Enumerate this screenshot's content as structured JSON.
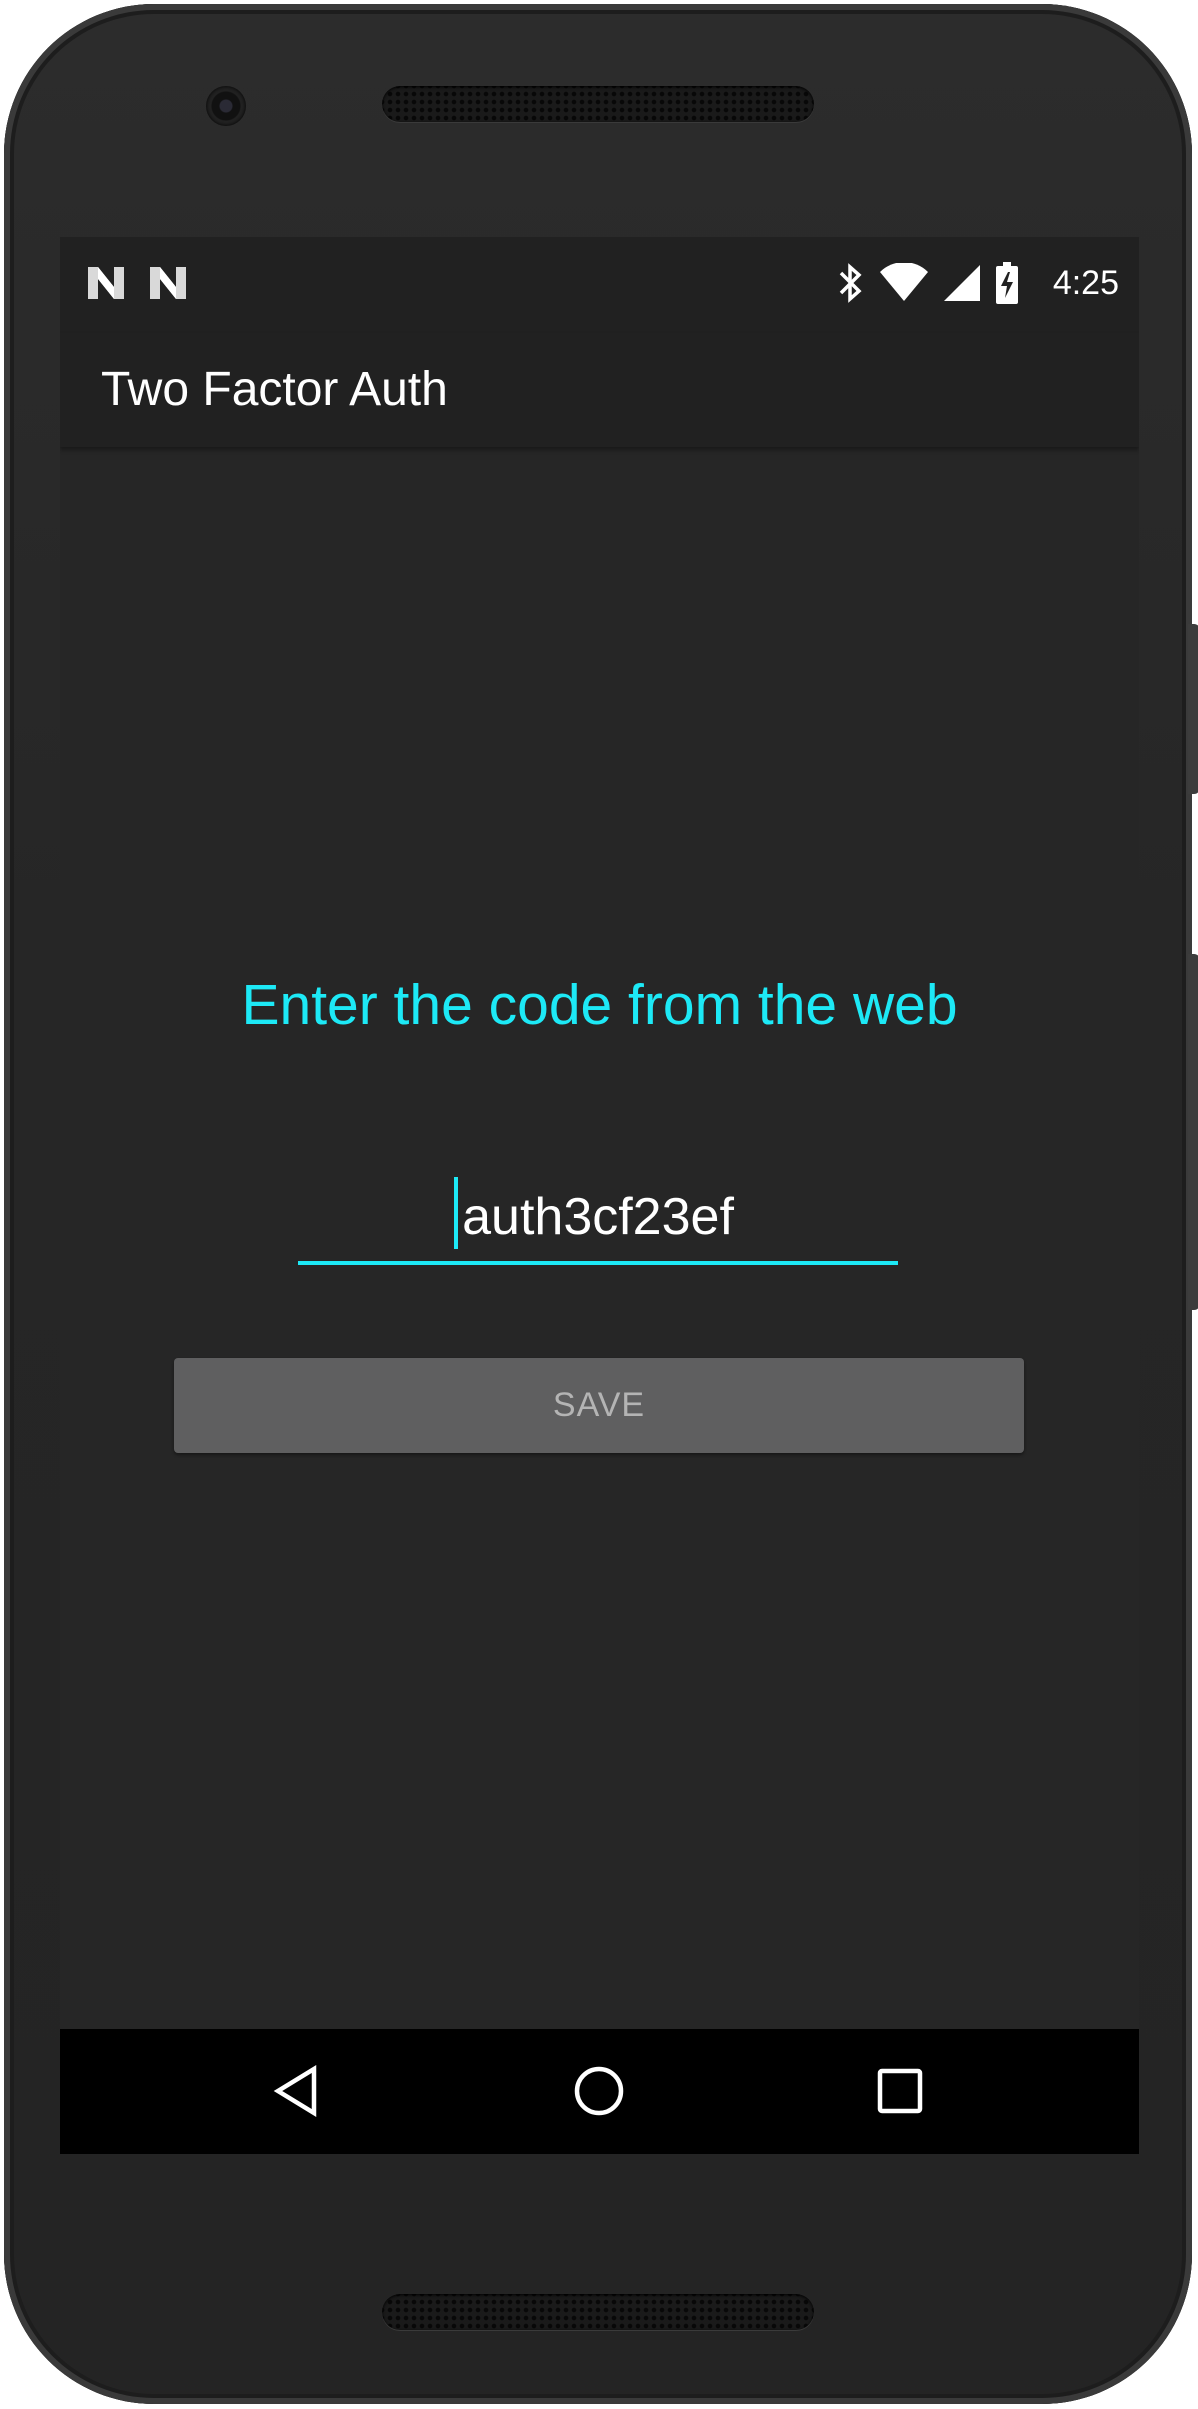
{
  "device": {
    "body_color": "#2a2a2a",
    "screen_color": "#262626"
  },
  "status_bar": {
    "notification_icons": [
      "n-notification-icon",
      "n-notification-icon"
    ],
    "system_icons": [
      "bluetooth-icon",
      "wifi-icon",
      "cellular-signal-icon",
      "battery-charging-icon"
    ],
    "time": "4:25"
  },
  "app_bar": {
    "title": "Two Factor Auth"
  },
  "main": {
    "prompt": "Enter the code from the web",
    "code_input": {
      "value": "auth3cf23ef"
    },
    "save_label": "SAVE",
    "accent_color": "#1de9f6"
  },
  "nav_bar": {
    "buttons": [
      "back-icon",
      "home-icon",
      "recent-apps-icon"
    ]
  }
}
